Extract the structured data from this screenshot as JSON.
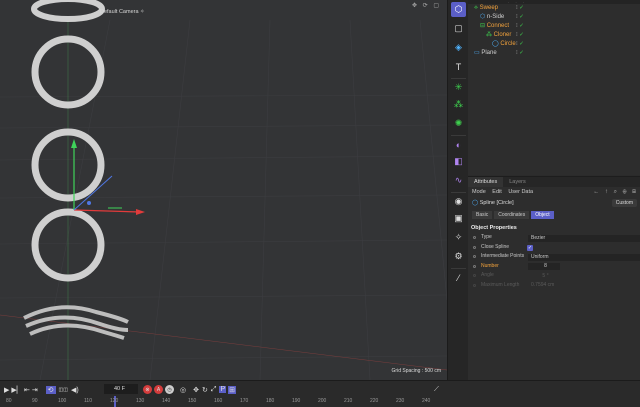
{
  "viewport": {
    "camera_label": "Default Camera ",
    "camera_icon": "bookmark-icon",
    "grid_spacing": "Grid Spacing : 500 cm",
    "view_icons": "✥ ⟳ ▢"
  },
  "object_manager": {
    "header_tabs": "···",
    "objects": [
      {
        "name": "Sweep",
        "indent": 0,
        "color": "#f2a23c",
        "icon": "sweep-icon"
      },
      {
        "name": "n-Side",
        "indent": 1,
        "color": "#d0d0d0",
        "icon": "nside-spline-icon"
      },
      {
        "name": "Connect",
        "indent": 1,
        "color": "#f2a23c",
        "icon": "connect-icon"
      },
      {
        "name": "Cloner",
        "indent": 2,
        "color": "#f2a23c",
        "icon": "cloner-icon"
      },
      {
        "name": "Circle",
        "indent": 3,
        "color": "#f2a23c",
        "icon": "circle-spline-icon"
      },
      {
        "name": "Plane",
        "indent": 0,
        "color": "#d0d0d0",
        "icon": "plane-icon"
      }
    ]
  },
  "attributes": {
    "tabs": [
      "Attributes",
      "Layers"
    ],
    "menu": [
      "Mode",
      "Edit",
      "User Data"
    ],
    "nav_icons": "← ↑ ⌕ ⊕ ⊞",
    "object_title": "Spline [Circle]",
    "custom_label": "Custom",
    "prop_tabs": [
      "Basic",
      "Coordinates",
      "Object"
    ],
    "section": "Object Properties",
    "properties": {
      "type_label": "Type",
      "type_value": "Bezier",
      "close_label": "Close Spline",
      "interp_label": "Intermediate Points",
      "interp_value": "Uniform",
      "number_label": "Number",
      "number_value": "8",
      "angle_label": "Angle",
      "angle_value": "5 °",
      "maxlen_label": "Maximum Length",
      "maxlen_value": "0.7594 cm"
    }
  },
  "timeline": {
    "frame": "40 F",
    "ruler": [
      "80",
      "90",
      "100",
      "110",
      "120",
      "130",
      "140",
      "150",
      "160",
      "170",
      "180",
      "190",
      "200",
      "210",
      "220",
      "230",
      "240"
    ],
    "record_icons": [
      "record-icon",
      "autokey-icon",
      "keyframe-icon"
    ]
  },
  "colors": {
    "accent": "#5b5fc7",
    "selected": "#f2a23c",
    "enabled": "#3ecf4e"
  }
}
